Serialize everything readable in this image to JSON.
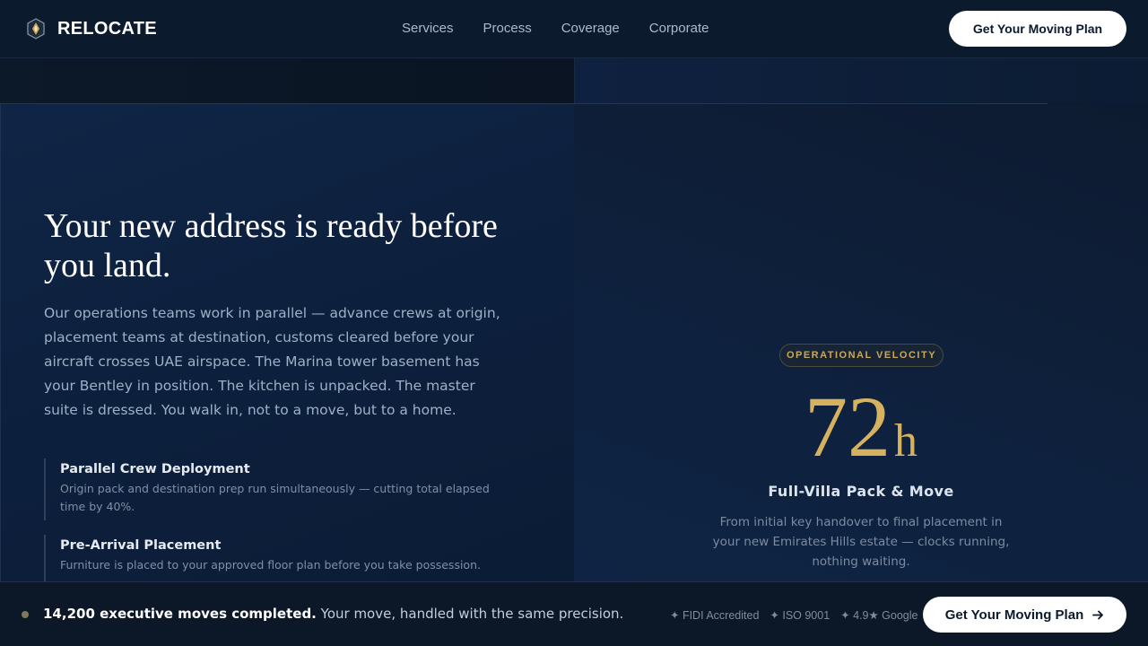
{
  "header": {
    "brand": "RELOCATE",
    "nav": [
      "Services",
      "Process",
      "Coverage",
      "Corporate"
    ],
    "cta": "Get Your Moving Plan"
  },
  "hero": {
    "title": "Your new address is ready before you land.",
    "body": "Our operations teams work in parallel — advance crews at origin, placement teams at destination, customs cleared before your aircraft crosses UAE airspace. The Marina tower basement has your Bentley in position. The kitchen is unpacked. The master suite is dressed. You walk in, not to a move, but to a home.",
    "features": [
      {
        "title": "Parallel Crew Deployment",
        "desc": "Origin pack and destination prep run simultaneously — cutting total elapsed time by 40%."
      },
      {
        "title": "Pre-Arrival Placement",
        "desc": "Furniture is placed to your approved floor plan before you take possession."
      }
    ]
  },
  "metric": {
    "badge": "OPERATIONAL VELOCITY",
    "value": "72",
    "unit": "h",
    "title": "Full-Villa Pack & Move",
    "desc": "From initial key handover to final placement in your new Emirates Hills estate — clocks running, nothing waiting."
  },
  "bottom": {
    "highlight": "14,200 executive moves completed.",
    "text": " Your move, handled with the same precision.",
    "trust": [
      "✦ FIDI Accredited",
      "✦ ISO 9001",
      "✦ 4.9★ Google"
    ],
    "cta": "Get Your Moving Plan",
    "cta_icon": "arrow-right-icon"
  },
  "colors": {
    "accent_gold": "#d6b25e",
    "bg_navy": "#0c1a2e"
  }
}
